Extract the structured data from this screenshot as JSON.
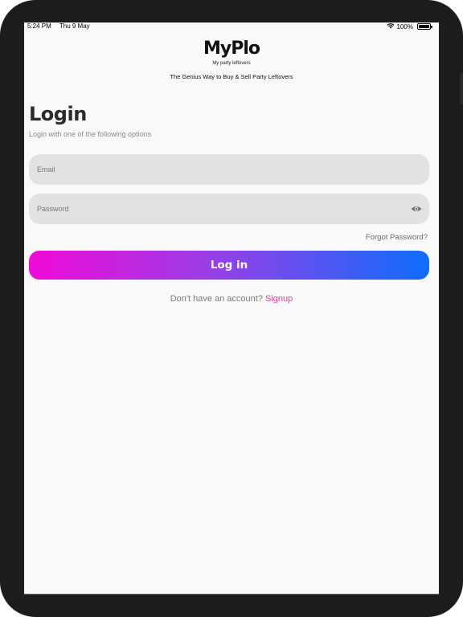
{
  "status_bar": {
    "time": "5:24 PM",
    "date": "Thu 9 May",
    "battery": "100%",
    "battery_level": 1.0,
    "wifi_icon": "wifi-icon"
  },
  "brand": {
    "logo_text": "MyPlo",
    "logo_subtitle": "My party leftovers",
    "tagline": "The Genius Way to Buy & Sell Party Leftovers"
  },
  "login": {
    "title": "Login",
    "subtitle": "Login with one of the following options",
    "email_placeholder": "Email",
    "password_placeholder": "Password",
    "forgot_label": "Forgot Password?",
    "button_label": "Log in",
    "no_account_text": "Don't have an account?",
    "signup_label": "Signup"
  },
  "colors": {
    "gradient_start": "#f00ad8",
    "gradient_end": "#0d6dfd",
    "signup_link": "#e0409a"
  }
}
